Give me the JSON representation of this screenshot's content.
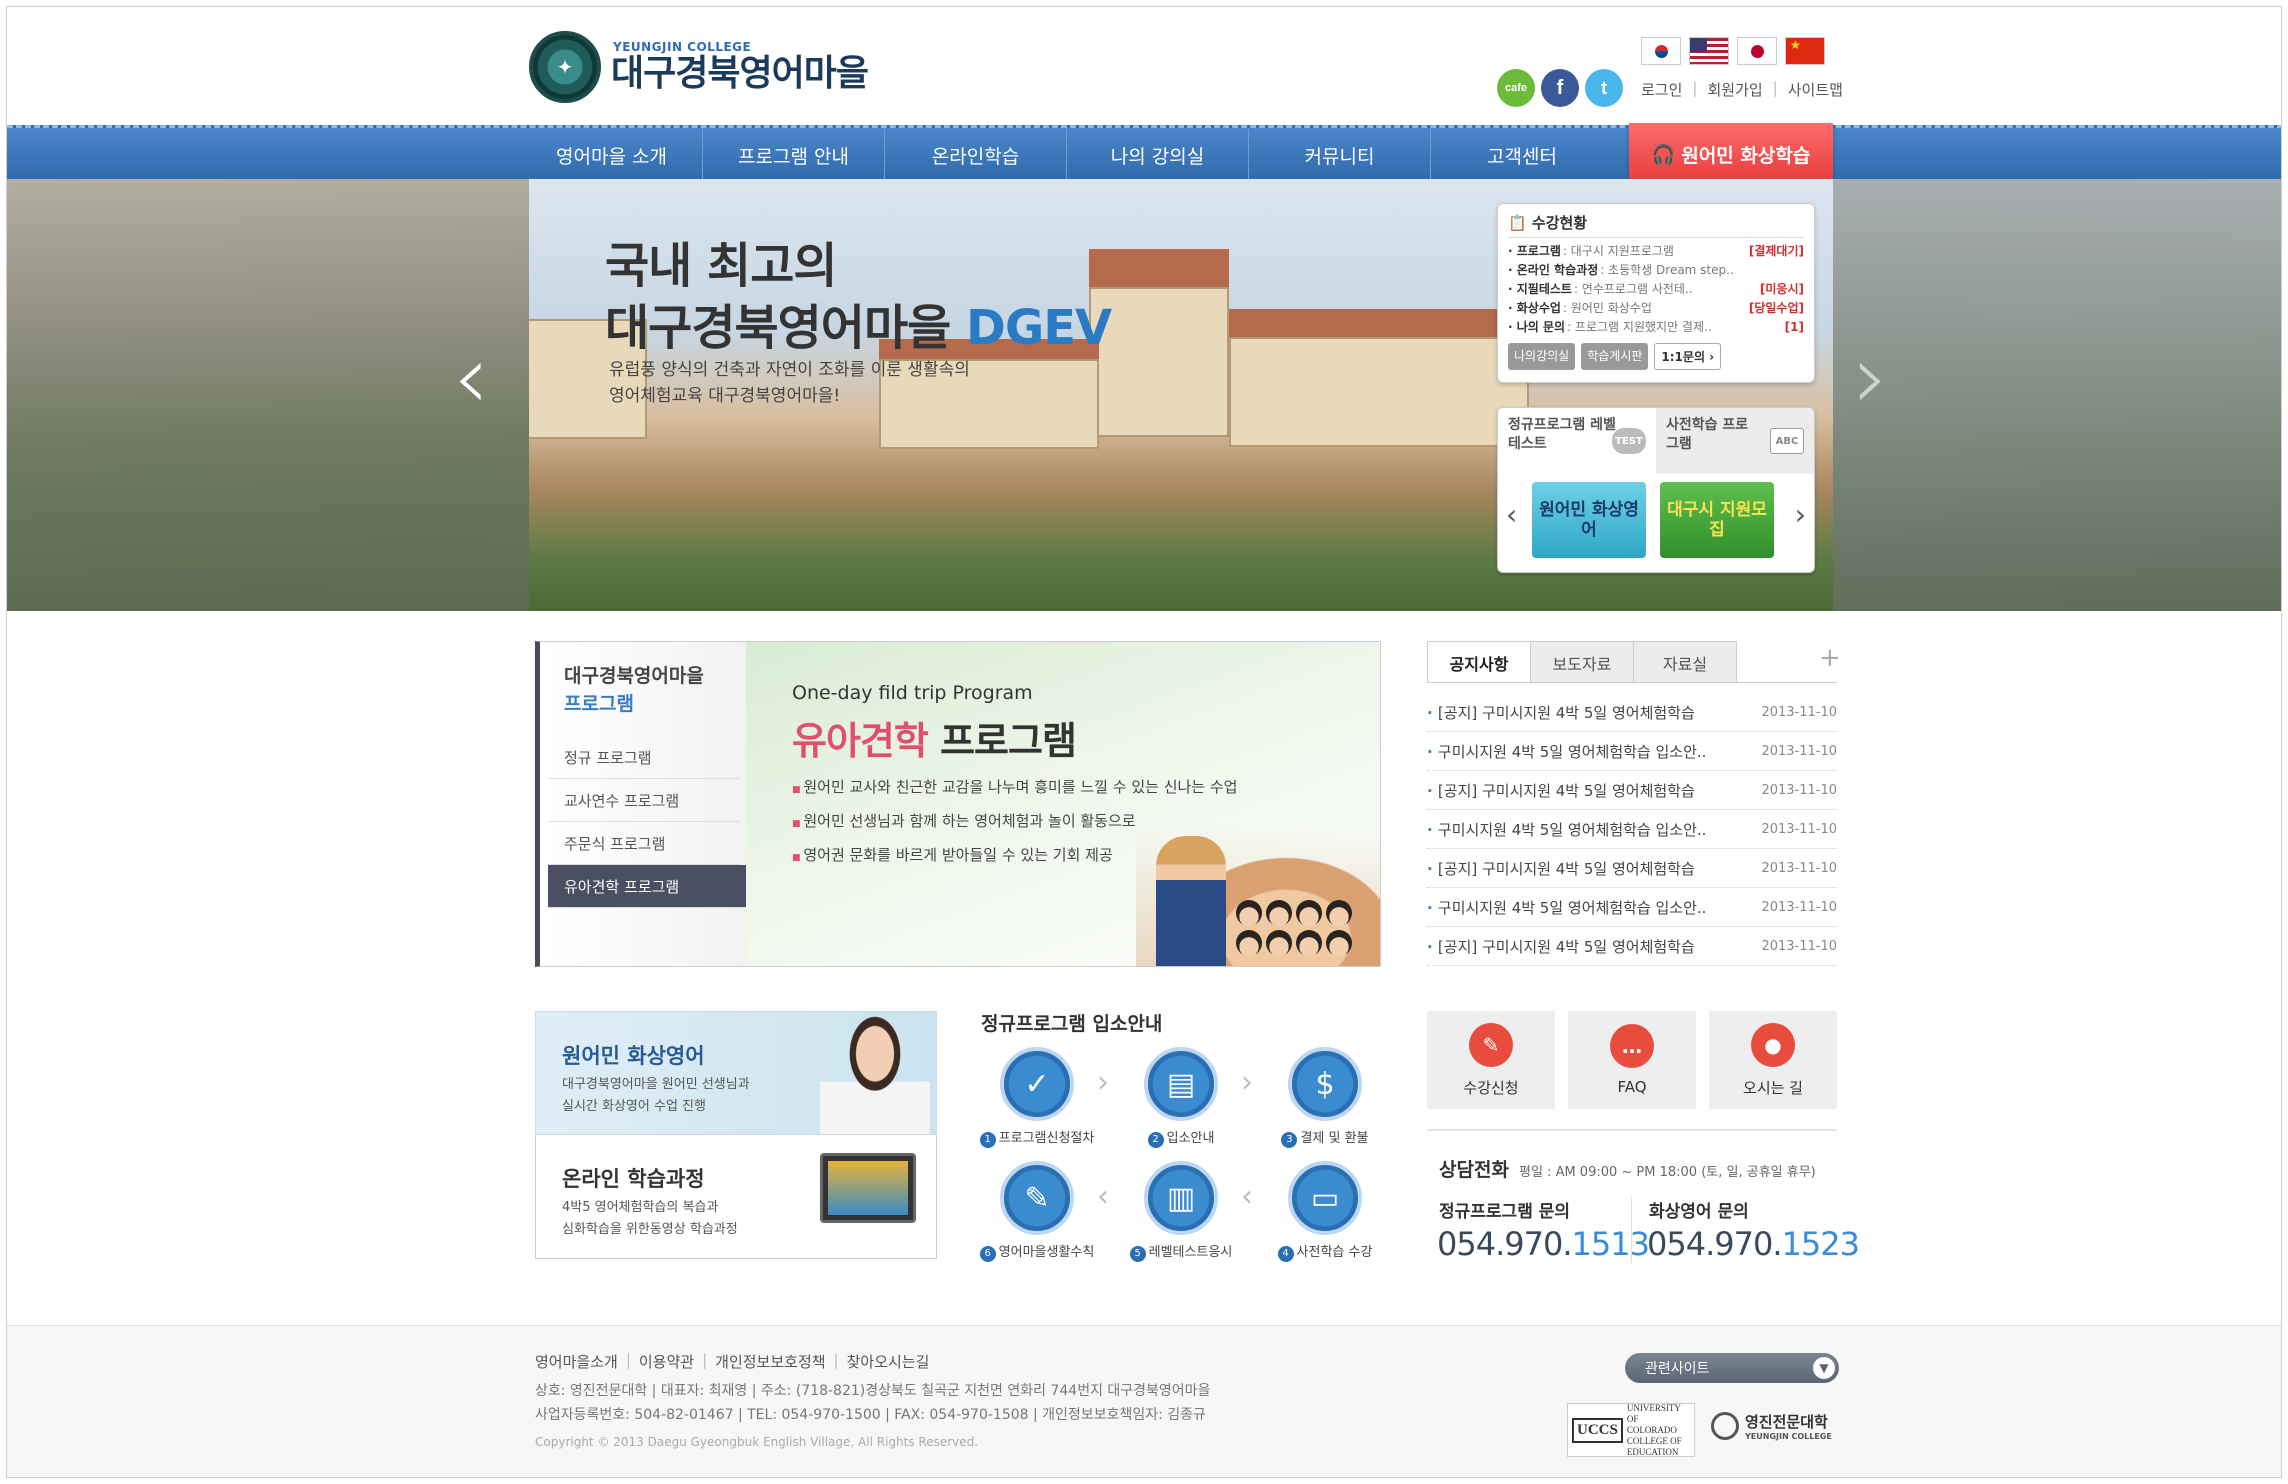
{
  "logo": {
    "small": "YEUNGJIN COLLEGE",
    "name": "대구경북영어마을"
  },
  "languages": [
    "korean-flag",
    "us-flag",
    "japan-flag",
    "china-flag"
  ],
  "social": {
    "cafe": "cafe",
    "facebook": "f",
    "twitter": "t"
  },
  "top_links": [
    "로그인",
    "회원가입",
    "사이트맵"
  ],
  "nav": [
    "영어마을 소개",
    "프로그램 안내",
    "온라인학습",
    "나의 강의실",
    "커뮤니티",
    "고객센터"
  ],
  "nav_special": "원어민 화상학습",
  "hero": {
    "title_line1": "국내 최고의",
    "title_line2": "대구경북영어마을",
    "title_en": "DGEV",
    "sub_line1": "유럽풍 양식의 건축과 자연이 조화를 이룬 생활속의",
    "sub_line2": "영어체험교육 대구경북영어마을!"
  },
  "status": {
    "title": "수강현황",
    "rows": [
      {
        "label": "· 프로그램",
        "value": ": 대구시 지원프로그램",
        "flag": "[결제대기]"
      },
      {
        "label": "· 온라인 학습과정",
        "value": ": 초등학생 Dream step..",
        "flag": ""
      },
      {
        "label": "· 지필테스트",
        "value": ": 연수프로그램 사전테..",
        "flag": "[미응시]"
      },
      {
        "label": "· 화상수업",
        "value": ": 원어민 화상수업",
        "flag": "[당일수업]"
      },
      {
        "label": "· 나의 문의",
        "value": ": 프로그램 지원했지만 결제..",
        "flag": "[1]"
      }
    ],
    "buttons": [
      "나의강의실",
      "학습게시판",
      "1:1문의 ›"
    ]
  },
  "quick_box": {
    "tab1": "정규프로그램 레벨테스트",
    "tab1_badge": "TEST",
    "tab2": "사전학습 프로그램",
    "tab2_badge": "ABC",
    "banner1": "원어민 화상영어",
    "banner2": "대구시 지원모집"
  },
  "program": {
    "side_title1": "대구경북영어마을",
    "side_title2": "프로그램",
    "menu": [
      "정규 프로그램",
      "교사연수 프로그램",
      "주문식 프로그램",
      "유아견학 프로그램"
    ],
    "active_index": 3,
    "en": "One-day fild trip Program",
    "title_pink": "유아견학",
    "title_rest": "프로그램",
    "bullets": [
      "원어민 교사와 친근한 교감을 나누며 흥미를 느낄 수 있는 신나는 수업",
      "원어민 선생님과 함께 하는 영어체험과 놀이 활동으로",
      "영어권 문화를 바르게 받아들일 수 있는 기회 제공"
    ]
  },
  "notice": {
    "tabs": [
      "공지사항",
      "보도자료",
      "자료실"
    ],
    "plus": "+",
    "items": [
      {
        "title": "[공지] 구미시지원 4박 5일 영어체험학습",
        "date": "2013-11-10"
      },
      {
        "title": "구미시지원 4박 5일 영어체험학습 입소안..",
        "date": "2013-11-10"
      },
      {
        "title": "[공지] 구미시지원 4박 5일 영어체험학습",
        "date": "2013-11-10"
      },
      {
        "title": "구미시지원 4박 5일 영어체험학습 입소안..",
        "date": "2013-11-10"
      },
      {
        "title": "[공지] 구미시지원 4박 5일 영어체험학습",
        "date": "2013-11-10"
      },
      {
        "title": "구미시지원 4박 5일 영어체험학습 입소안..",
        "date": "2013-11-10"
      },
      {
        "title": "[공지] 구미시지원 4박 5일 영어체험학습",
        "date": "2013-11-10"
      }
    ]
  },
  "cards": {
    "card1_title": "원어민 화상영어",
    "card1_desc1": "대구경북영어마을 원어민 선생님과",
    "card1_desc2": "실시간 화상영어 수업 진행",
    "card2_title": "온라인 학습과정",
    "card2_desc1": "4박5 영어체험학습의 복습과",
    "card2_desc2": "심화학습을 위한동영상 학습과정"
  },
  "process": {
    "title": "정규프로그램 입소안내",
    "steps": [
      {
        "n": "1",
        "label": "프로그램신청절차",
        "icon": "clipboard-icon"
      },
      {
        "n": "2",
        "label": "입소안내",
        "icon": "id-card-icon"
      },
      {
        "n": "3",
        "label": "결제 및 환불",
        "icon": "dollar-icon"
      },
      {
        "n": "4",
        "label": "사전학습 수강",
        "icon": "monitor-icon"
      },
      {
        "n": "5",
        "label": "레벨테스트응시",
        "icon": "chart-icon"
      },
      {
        "n": "6",
        "label": "영어마을생활수칙",
        "icon": "notepad-icon"
      }
    ]
  },
  "quick_icons": [
    "수강신청",
    "FAQ",
    "오시는 길"
  ],
  "consult": {
    "title": "상담전화",
    "hours": "평일 : AM 09:00 ~ PM 18:00 (토, 일, 공휴일 휴무)",
    "label1": "정규프로그램 문의",
    "num1_a": "054.970.",
    "num1_b": "1513",
    "label2": "화상영어 문의",
    "num2_a": "054.970.",
    "num2_b": "1523"
  },
  "footer": {
    "links": [
      "영어마을소개",
      "이용약관",
      "개인정보보호정책",
      "찾아오시는길"
    ],
    "info1": "상호: 영진전문대학 | 대표자: 최재영 | 주소: (718-821)경상북도 칠곡군 지천면 연화리 744번지 대구경북영어마을",
    "info2": "사업자등록번호: 504-82-01467 | TEL: 054-970-1500 | FAX: 054-970-1508 | 개인정보보호책임자: 김종규",
    "copyright": "Copyright © 2013 Daegu Gyeongbuk English Village, All Rights Reserved.",
    "related": "관련사이트",
    "uccs_mark": "UCCS",
    "uccs_text1": "UNIVERSITY OF",
    "uccs_text2": "COLORADO",
    "uccs_text3": "COLLEGE OF EDUCATION",
    "yj_name": "영진전문대학",
    "yj_en": "YEUNGJIN COLLEGE"
  },
  "colors": {
    "nav_blue": "#3b78bd",
    "accent_red": "#e63b3b",
    "pink": "#e0506c",
    "link_blue": "#3a8bd8"
  }
}
